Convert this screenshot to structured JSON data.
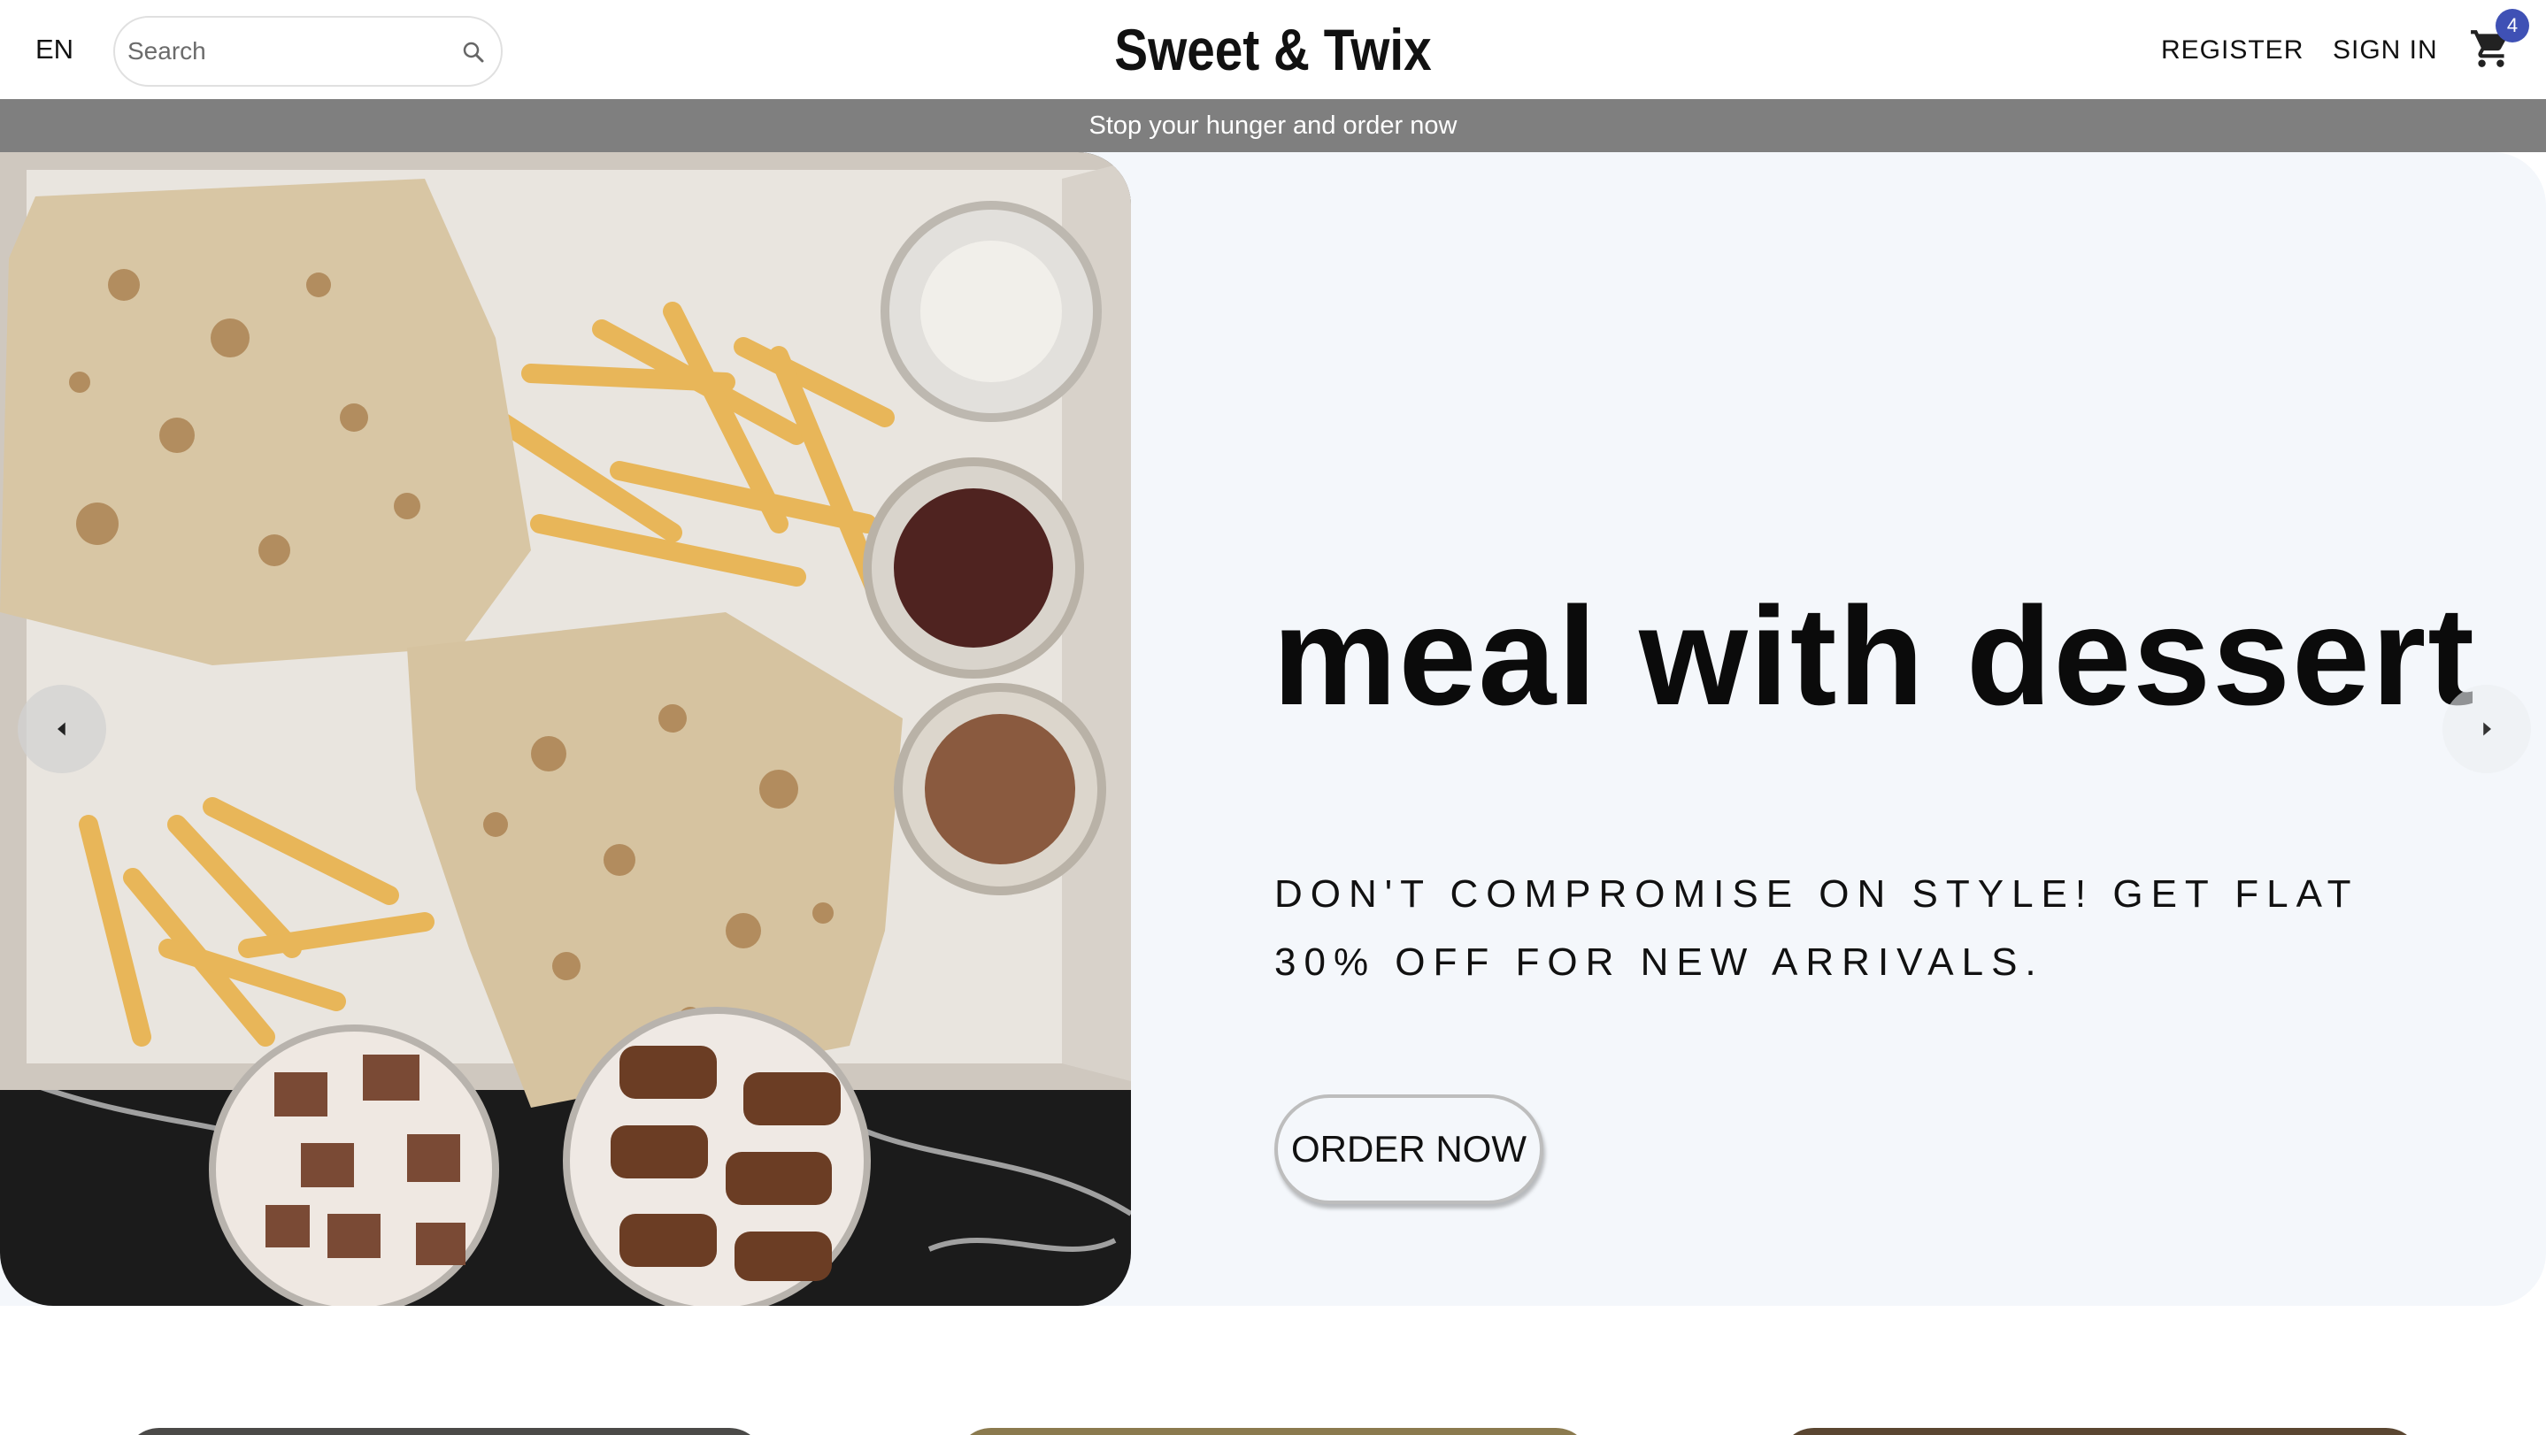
{
  "header": {
    "language": "EN",
    "search_placeholder": "Search",
    "brand": "Sweet & Twix",
    "register_label": "REGISTER",
    "signin_label": "SIGN IN",
    "cart_count": "4"
  },
  "announcement": "Stop your hunger and order now",
  "hero": {
    "title": "meal with dessert",
    "subtitle": "DON'T COMPROMISE ON STYLE! GET FLAT 30% OFF FOR NEW ARRIVALS.",
    "cta_label": "ORDER NOW"
  },
  "icons": {
    "search": "search-icon",
    "cart": "cart-icon",
    "prev": "chevron-left-icon",
    "next": "chevron-right-icon"
  },
  "colors": {
    "badge": "#3f51b5",
    "announcement_bg": "#7f7f7f",
    "hero_bg": "#f4f7fb"
  }
}
